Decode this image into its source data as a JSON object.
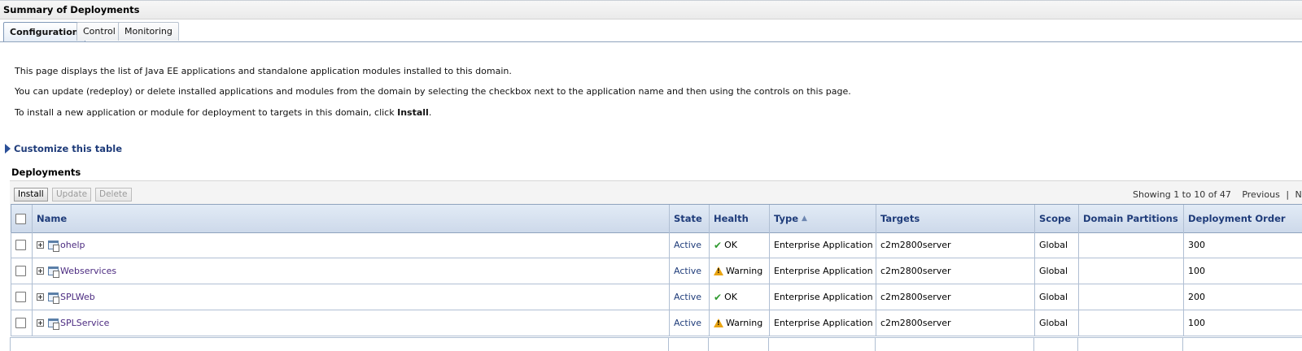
{
  "page": {
    "title": "Summary of Deployments",
    "tabs": [
      {
        "label": "Configuration",
        "active": true
      },
      {
        "label": "Control",
        "active": false
      },
      {
        "label": "Monitoring",
        "active": false
      }
    ],
    "desc1": "This page displays the list of Java EE applications and standalone application modules installed to this domain.",
    "desc2": "You can update (redeploy) or delete installed applications and modules from the domain by selecting the checkbox next to the application name and then using the controls on this page.",
    "desc3_prefix": "To install a new application or module for deployment to targets in this domain, click ",
    "desc3_bold": "Install",
    "desc3_suffix": "."
  },
  "customize": {
    "label": "Customize this table"
  },
  "deployments": {
    "title": "Deployments",
    "toolbar": {
      "install": "Install",
      "update": "Update",
      "delete": "Delete",
      "showing": "Showing 1 to 10 of 47",
      "previous": "Previous",
      "separator": "|",
      "next_partial": "N"
    },
    "columns": {
      "name": "Name",
      "state": "State",
      "health": "Health",
      "type": "Type",
      "targets": "Targets",
      "scope": "Scope",
      "domain_partitions": "Domain Partitions",
      "deployment_order": "Deployment Order"
    },
    "rows": [
      {
        "name": "ohelp",
        "state": "Active",
        "health": "OK",
        "health_icon": "check-icon",
        "type": "Enterprise Application",
        "targets": "c2m2800server",
        "scope": "Global",
        "partitions": "",
        "order": "300"
      },
      {
        "name": "Webservices",
        "state": "Active",
        "health": "Warning",
        "health_icon": "warning-icon",
        "type": "Enterprise Application",
        "targets": "c2m2800server",
        "scope": "Global",
        "partitions": "",
        "order": "100"
      },
      {
        "name": "SPLWeb",
        "state": "Active",
        "health": "OK",
        "health_icon": "check-icon",
        "type": "Enterprise Application",
        "targets": "c2m2800server",
        "scope": "Global",
        "partitions": "",
        "order": "200"
      },
      {
        "name": "SPLService",
        "state": "Active",
        "health": "Warning",
        "health_icon": "warning-icon",
        "type": "Enterprise Application",
        "targets": "c2m2800server",
        "scope": "Global",
        "partitions": "",
        "order": "100"
      }
    ]
  },
  "colors": {
    "header_text": "#1f3c7a",
    "link": "#4b2a80",
    "ok": "#2f9a2f",
    "warning": "#e9a412"
  }
}
